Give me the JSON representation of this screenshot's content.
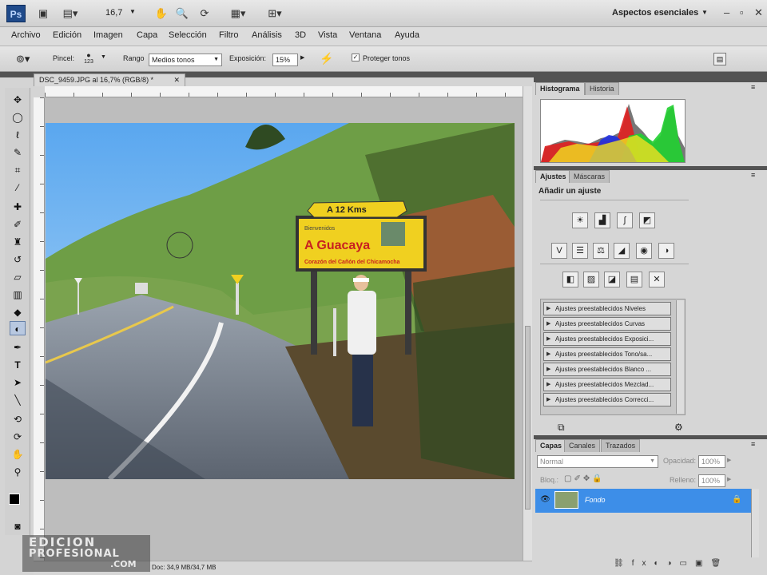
{
  "topbar": {
    "app_logo": "Ps",
    "zoom": "16,7",
    "workspace": "Aspectos esenciales"
  },
  "menu": [
    "Archivo",
    "Edición",
    "Imagen",
    "Capa",
    "Selección",
    "Filtro",
    "Análisis",
    "3D",
    "Vista",
    "Ventana",
    "Ayuda"
  ],
  "options": {
    "brush_label": "Pincel:",
    "brush_size": "123",
    "range_label": "Rango",
    "range_value": "Medios tonos",
    "exposure_label": "Exposición:",
    "exposure_value": "15%",
    "protect_label": "Proteger tonos"
  },
  "document": {
    "tab": "DSC_9459.JPG al 16,7% (RGB/8) *",
    "status": "Doc: 34,9 MB/34,7 MB"
  },
  "photo": {
    "sign_top": "A 12 Kms",
    "sign_welcome": "Bienvenidos",
    "sign_town": "A Guacaya",
    "sign_sub": "Corazón del Cañón del Chicamocha"
  },
  "panels": {
    "histogram_tabs": [
      "Histograma",
      "Historia"
    ],
    "adjust_tabs": [
      "Ajustes",
      "Máscaras"
    ],
    "adjust_title": "Añadir un ajuste",
    "presets": [
      "Ajustes preestablecidos Niveles",
      "Ajustes preestablecidos Curvas",
      "Ajustes preestablecidos Exposici...",
      "Ajustes preestablecidos Tono/sa...",
      "Ajustes preestablecidos Blanco ...",
      "Ajustes preestablecidos Mezclad...",
      "Ajustes preestablecidos Correcci..."
    ],
    "layer_tabs": [
      "Capas",
      "Canales",
      "Trazados"
    ],
    "blend_mode": "Normal",
    "opacity_label": "Opacidad:",
    "opacity_value": "100%",
    "lock_label": "Bloq.:",
    "fill_label": "Relleno:",
    "fill_value": "100%",
    "layer_name": "Fondo"
  },
  "watermark": {
    "line1": "EDICION",
    "line2": "PROFESIONAL",
    "line3": ".COM"
  },
  "colors": {
    "accent": "#3d8ee8",
    "panel_dark": "#535353"
  }
}
